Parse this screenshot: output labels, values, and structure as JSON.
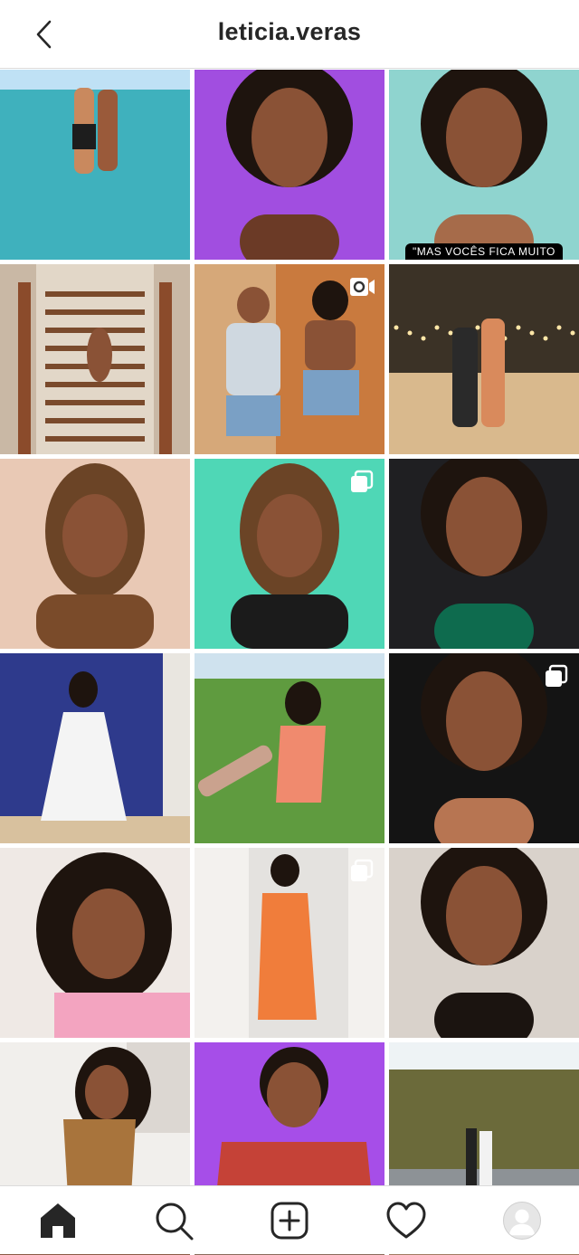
{
  "header": {
    "username": "leticia.veras",
    "back_icon": "chevron-left-icon"
  },
  "posts": [
    {
      "kind": "photo",
      "scene": "beach",
      "colors": {
        "bg": "#55b8c6",
        "fg": "#e6c49e"
      }
    },
    {
      "kind": "photo",
      "scene": "portrait",
      "colors": {
        "bg": "#a14ee0",
        "fg": "#6b3a26"
      }
    },
    {
      "kind": "photo",
      "scene": "portrait",
      "colors": {
        "bg": "#8fd4cf",
        "fg": "#a66b4a"
      },
      "caption": "\"MAS VOCÊS FICA MUITO"
    },
    {
      "kind": "photo",
      "scene": "stairs",
      "colors": {
        "bg": "#c9b8a5",
        "fg": "#8b4b2b"
      }
    },
    {
      "kind": "video",
      "scene": "duo",
      "colors": {
        "bg": "#d6a879",
        "fg": "#7aa0c5"
      },
      "badge": "igtv-icon"
    },
    {
      "kind": "photo",
      "scene": "night",
      "colors": {
        "bg": "#3b3226",
        "fg": "#e6c08a"
      }
    },
    {
      "kind": "photo",
      "scene": "braids",
      "colors": {
        "bg": "#e9c9b5",
        "fg": "#7a4b2a"
      }
    },
    {
      "kind": "carousel",
      "scene": "braids-green",
      "colors": {
        "bg": "#4fd7b6",
        "fg": "#1b1b1b"
      },
      "badge": "carousel-icon"
    },
    {
      "kind": "photo",
      "scene": "graduation",
      "colors": {
        "bg": "#1f1f22",
        "fg": "#0e6b4e"
      }
    },
    {
      "kind": "photo",
      "scene": "white-dress",
      "colors": {
        "bg": "#2e3a8c",
        "fg": "#f4f4f4"
      }
    },
    {
      "kind": "photo",
      "scene": "field",
      "colors": {
        "bg": "#5f9b3f",
        "fg": "#f08a6e"
      }
    },
    {
      "kind": "carousel",
      "scene": "curls",
      "colors": {
        "bg": "#141414",
        "fg": "#b77552"
      },
      "badge": "carousel-icon"
    },
    {
      "kind": "photo",
      "scene": "curls-pink",
      "colors": {
        "bg": "#efe9e5",
        "fg": "#f3a4c0"
      }
    },
    {
      "kind": "carousel",
      "scene": "colorful-dress",
      "colors": {
        "bg": "#e4e2df",
        "fg": "#f07d3b"
      },
      "badge": "carousel-icon"
    },
    {
      "kind": "photo",
      "scene": "curls-close",
      "colors": {
        "bg": "#d9d2cb",
        "fg": "#1b1410"
      }
    },
    {
      "kind": "photo",
      "scene": "tie-dye",
      "colors": {
        "bg": "#f1efec",
        "fg": "#a8743c"
      }
    },
    {
      "kind": "photo",
      "scene": "red-shirt",
      "colors": {
        "bg": "#a64ee8",
        "fg": "#c54237"
      }
    },
    {
      "kind": "photo",
      "scene": "pier",
      "colors": {
        "bg": "#6b6a3a",
        "fg": "#9fa3a7"
      }
    },
    {
      "kind": "partial",
      "colors": {
        "bg": "#8a5a44"
      }
    },
    {
      "kind": "partial",
      "colors": {
        "bg": "#8a6a5a"
      }
    },
    {
      "kind": "partial",
      "colors": {
        "bg": "#a07a60"
      }
    }
  ],
  "nav": {
    "items": [
      {
        "name": "home",
        "icon": "home-icon",
        "active": true
      },
      {
        "name": "search",
        "icon": "search-icon",
        "active": false
      },
      {
        "name": "new-post",
        "icon": "add-post-icon",
        "active": false
      },
      {
        "name": "activity",
        "icon": "heart-icon",
        "active": false
      },
      {
        "name": "profile",
        "icon": "avatar-icon",
        "active": false
      }
    ]
  }
}
